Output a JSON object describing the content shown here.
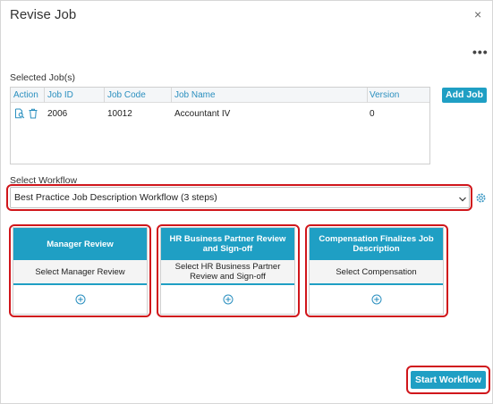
{
  "dialog": {
    "title": "Revise Job",
    "close_glyph": "×",
    "more_glyph": "•••"
  },
  "jobs": {
    "section_label": "Selected Job(s)",
    "add_job_label": "Add Job",
    "columns": [
      "Action",
      "Job ID",
      "Job Code",
      "Job Name",
      "Version"
    ],
    "rows": [
      {
        "job_id": "2006",
        "job_code": "10012",
        "job_name": "Accountant IV",
        "version": "0"
      }
    ],
    "action_icons": [
      "preview-icon",
      "trash-icon"
    ]
  },
  "workflow": {
    "section_label": "Select Workflow",
    "selected": "Best Practice Job Description Workflow (3 steps)",
    "settings_icon": "gear-icon"
  },
  "steps": [
    {
      "title": "Manager Review",
      "select_label": "Select Manager Review"
    },
    {
      "title": "HR Business Partner Review and Sign-off",
      "select_label": "Select HR Business Partner Review and Sign-off"
    },
    {
      "title": "Compensation Finalizes Job Description",
      "select_label": "Select Compensation"
    }
  ],
  "footer": {
    "start_label": "Start Workflow"
  },
  "colors": {
    "accent": "#1f9fc4",
    "highlight": "#d0161b",
    "header_text": "#2a8fbf"
  }
}
